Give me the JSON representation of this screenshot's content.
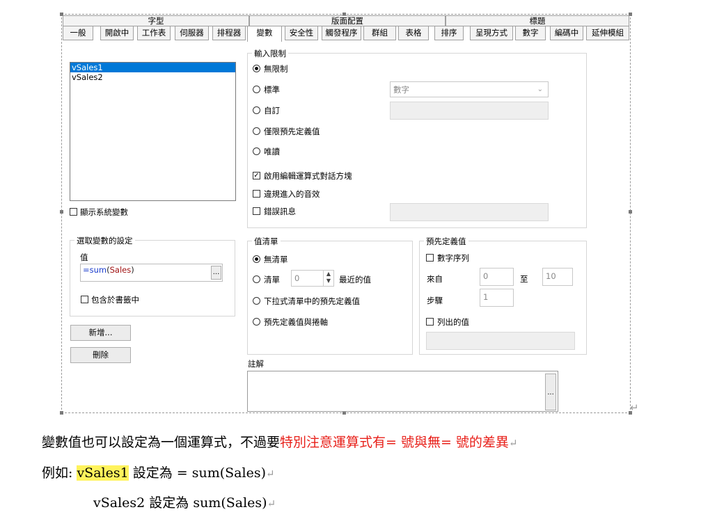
{
  "dialog": {
    "group_tabs": [
      "字型",
      "版面配置",
      "標題"
    ],
    "tabs": [
      "一般",
      "開啟中",
      "工作表",
      "伺服器",
      "排程器",
      "變數",
      "安全性",
      "觸發程序",
      "群組",
      "表格",
      "排序",
      "呈現方式",
      "數字",
      "編碼中",
      "延伸模組"
    ],
    "active_tab": "變數",
    "variables": [
      "vSales1",
      "vSales2"
    ],
    "show_system_vars": "顯示系統變數",
    "selected_settings": {
      "legend": "選取變數的設定",
      "value_label": "值",
      "expr_eq": "=",
      "expr_fn": "sum",
      "expr_open": "(",
      "expr_arg": "Sales",
      "expr_close": ")",
      "browse": "...",
      "include_bookmark": "包含於書籤中"
    },
    "add_button": "新增...",
    "delete_button": "刪除",
    "input_constraint": {
      "legend": "輸入限制",
      "none": "無限制",
      "standard": "標準",
      "standard_select": "數字",
      "custom": "自訂",
      "predefined_only": "僅限預先定義值",
      "readonly": "唯讀",
      "enable_expr_dialog": "啟用編輯運算式對話方塊",
      "illegal_sound": "違規進入的音效",
      "error_message": "錯誤訊息"
    },
    "value_list": {
      "legend": "值清單",
      "no_list": "無清單",
      "list": "清單",
      "list_count": "0",
      "recent_values": "最近的值",
      "dropdown_predef": "下拉式清單中的預先定義值",
      "predef_and_scroll": "預先定義值與捲軸"
    },
    "predefined": {
      "legend": "預先定義值",
      "numeric_series": "數字序列",
      "from_label": "來自",
      "from_value": "0",
      "to_label": "至",
      "to_value": "10",
      "step_label": "步驟",
      "step_value": "1",
      "listed_values": "列出的值"
    },
    "comment": {
      "legend": "註解",
      "browse": "..."
    }
  },
  "body_text": {
    "line1_prefix": "變數值也可以設定為一個運算式，不過要",
    "line1_red": "特別注意運算式有= 號與無= 號的差異",
    "line2_prefix": "例如: ",
    "line2_highlight": "vSales1",
    "line2_rest": " 設定為 = sum(Sales)",
    "line3": "vSales2 設定為 sum(Sales)",
    "return_mark": "↵"
  },
  "colors": {
    "red_text": "#e8201a",
    "highlight": "#fff35c",
    "selection": "#0078d7",
    "expr_blue": "#1a3ccc",
    "expr_red": "#a01010"
  }
}
